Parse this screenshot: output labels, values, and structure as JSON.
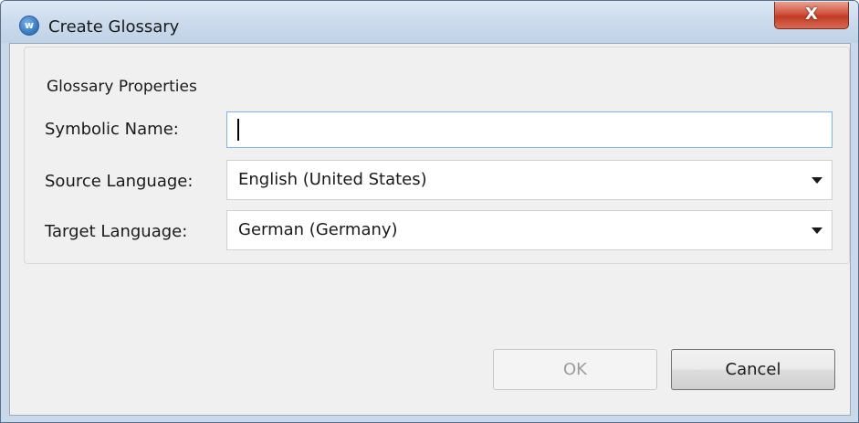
{
  "window": {
    "title": "Create Glossary",
    "icon": "app-logo-icon",
    "close_glyph": "X"
  },
  "group": {
    "legend": "Glossary Properties"
  },
  "fields": {
    "symbolic_name": {
      "label": "Symbolic Name:",
      "value": ""
    },
    "source_language": {
      "label": "Source Language:",
      "value": "English (United States)"
    },
    "target_language": {
      "label": "Target Language:",
      "value": "German (Germany)"
    }
  },
  "buttons": {
    "ok": {
      "label": "OK",
      "enabled": false
    },
    "cancel": {
      "label": "Cancel",
      "enabled": true
    }
  },
  "colors": {
    "close_button": "#c23a24",
    "input_focus_border": "#7eb4ea",
    "disabled_text": "#9c9c9c"
  }
}
